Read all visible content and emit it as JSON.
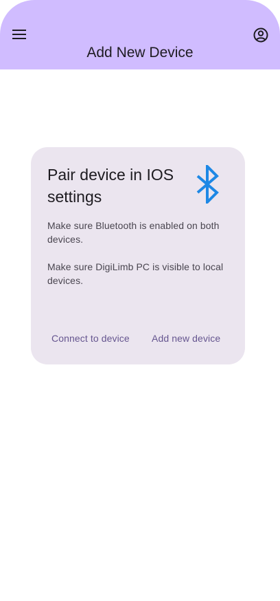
{
  "app_bar": {
    "title": "Add New Device",
    "menu_icon": "menu-icon",
    "account_icon": "account-circle-icon",
    "background_color": "#d0bcff"
  },
  "card": {
    "title": "Pair device in IOS settings",
    "icon": "bluetooth-icon",
    "icon_color": "#1e88e5",
    "instructions": [
      "Make sure Bluetooth is enabled on both devices.",
      "Make sure DigiLimb PC is visible to local devices."
    ],
    "actions": {
      "connect_label": "Connect to device",
      "add_label": "Add new device"
    },
    "background_color": "#ebe5ef"
  }
}
